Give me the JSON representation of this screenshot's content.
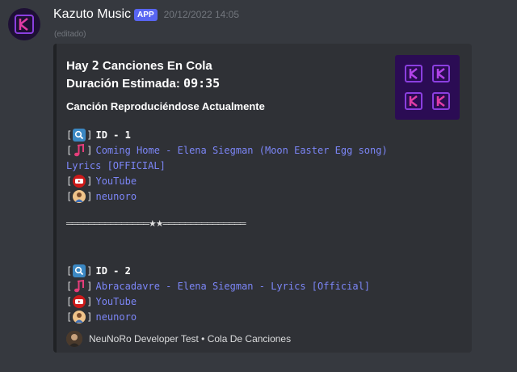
{
  "bot": {
    "name": "Kazuto Music",
    "tag": "APP",
    "timestamp": "20/12/2022 14:05",
    "edited": "(editado)"
  },
  "embed": {
    "queue_prefix": "Hay ",
    "queue_count": "2",
    "queue_suffix": " Canciones En Cola",
    "duration_label": "Duración Estimada: ",
    "duration_value": "09:35",
    "subtitle": "Canción Reproduciéndose Actualmente",
    "separator": "═══════════════★★═══════════════",
    "tracks": [
      {
        "id_text": "ID - 1",
        "title_line1": "Coming Home - Elena Siegman (Moon Easter Egg song)",
        "title_line2": "Lyrics [OFFICIAL]",
        "source": "YouTube",
        "requester": "neunoro"
      },
      {
        "id_text": "ID - 2",
        "title_line1": "Abracadavre - Elena Siegman - Lyrics [Official]",
        "source": "YouTube",
        "requester": "neunoro"
      }
    ],
    "footer": "NeuNoRo Developer Test • Cola De Canciones"
  },
  "colors": {
    "background": "#36393f",
    "embed_bg": "#2f3136",
    "link": "#7c86f7",
    "app_tag": "#5865f2",
    "thumb_bg": "#2b0c54",
    "brand_purple": "#9b3df2",
    "note_pink": "#e53d7a"
  },
  "icons": {
    "search": "magnifier-icon",
    "note": "music-note-icon",
    "youtube": "youtube-icon",
    "user": "user-avatar-icon"
  }
}
